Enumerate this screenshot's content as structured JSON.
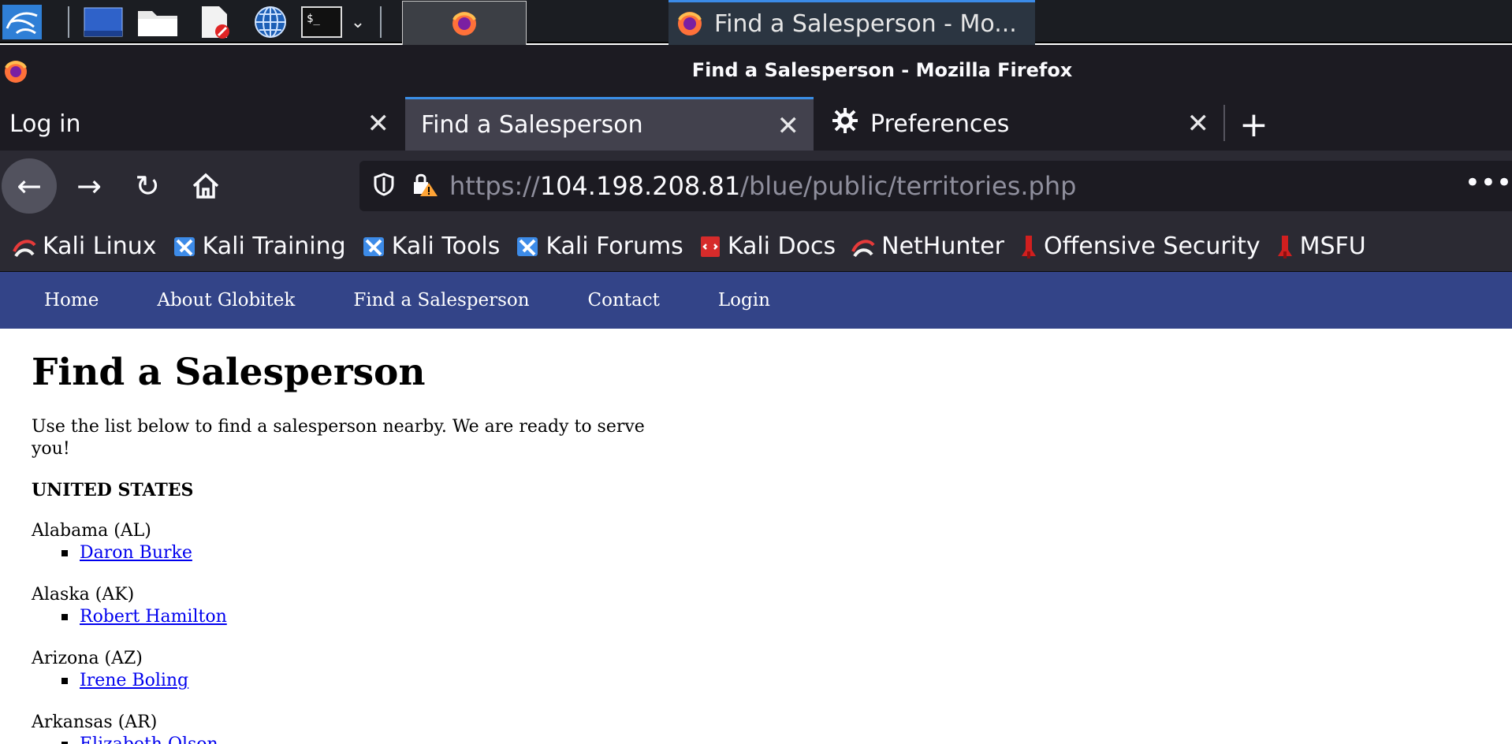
{
  "taskbar": {
    "window_title": "Find a Salesperson - Mo..."
  },
  "window": {
    "title": "Find a Salesperson - Mozilla Firefox"
  },
  "tabs": [
    {
      "label": "Log in",
      "active": false
    },
    {
      "label": "Find a Salesperson",
      "active": true
    },
    {
      "label": "Preferences",
      "active": false
    }
  ],
  "urlbar": {
    "scheme": "https://",
    "host": "104.198.208.81",
    "path": "/blue/public/territories.php"
  },
  "bookmarks": [
    {
      "label": "Kali Linux",
      "icon": "kali-dragon-icon"
    },
    {
      "label": "Kali Training",
      "icon": "kali-tool-icon"
    },
    {
      "label": "Kali Tools",
      "icon": "kali-tool-icon"
    },
    {
      "label": "Kali Forums",
      "icon": "kali-tool-icon"
    },
    {
      "label": "Kali Docs",
      "icon": "kali-docs-icon"
    },
    {
      "label": "NetHunter",
      "icon": "kali-dragon-icon"
    },
    {
      "label": "Offensive Security",
      "icon": "offsec-icon"
    },
    {
      "label": "MSFU",
      "icon": "offsec-icon"
    }
  ],
  "site_nav": [
    "Home",
    "About Globitek",
    "Find a Salesperson",
    "Contact",
    "Login"
  ],
  "page": {
    "heading": "Find a Salesperson",
    "intro": "Use the list below to find a salesperson nearby. We are ready to serve you!",
    "country": "UNITED STATES",
    "states": [
      {
        "name": "Alabama (AL)",
        "people": [
          "Daron Burke"
        ]
      },
      {
        "name": "Alaska (AK)",
        "people": [
          "Robert Hamilton"
        ]
      },
      {
        "name": "Arizona (AZ)",
        "people": [
          "Irene Boling"
        ]
      },
      {
        "name": "Arkansas (AR)",
        "people": [
          "Elizabeth Olson"
        ]
      }
    ]
  },
  "colors": {
    "site_nav_bg": "#334488",
    "link": "#0000ee",
    "tab_accent": "#3a8ee6"
  }
}
